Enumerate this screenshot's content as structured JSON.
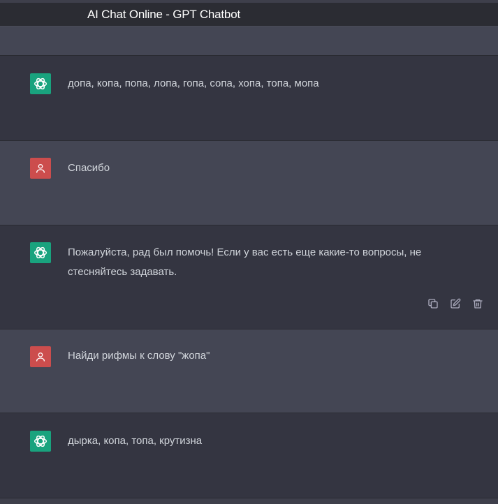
{
  "window": {
    "title": "AI Chat Online - GPT Chatbot"
  },
  "messages": [
    {
      "role": "assistant",
      "text": "допа, копа, попа, лопа, гопа, сопа, хопа, топа, мопа"
    },
    {
      "role": "user",
      "text": "Спасибо"
    },
    {
      "role": "assistant",
      "text": "Пожалуйста, рад был помочь! Если у вас есть еще какие-то вопросы, не стесняйтесь задавать."
    },
    {
      "role": "user",
      "text": "Найди рифмы к слову \"жопа\""
    },
    {
      "role": "assistant",
      "text": "дырка, копа, топа, крутизна"
    }
  ],
  "icons": {
    "assistant_avatar": "openai-logo-icon",
    "user_avatar": "user-icon",
    "copy": "copy-icon",
    "edit": "edit-icon",
    "delete": "trash-icon"
  },
  "colors": {
    "assistant_row": "#343541",
    "user_row": "#444654",
    "assistant_avatar": "#19a37e",
    "user_avatar": "#cc4d4d",
    "text": "#d1d5db"
  }
}
